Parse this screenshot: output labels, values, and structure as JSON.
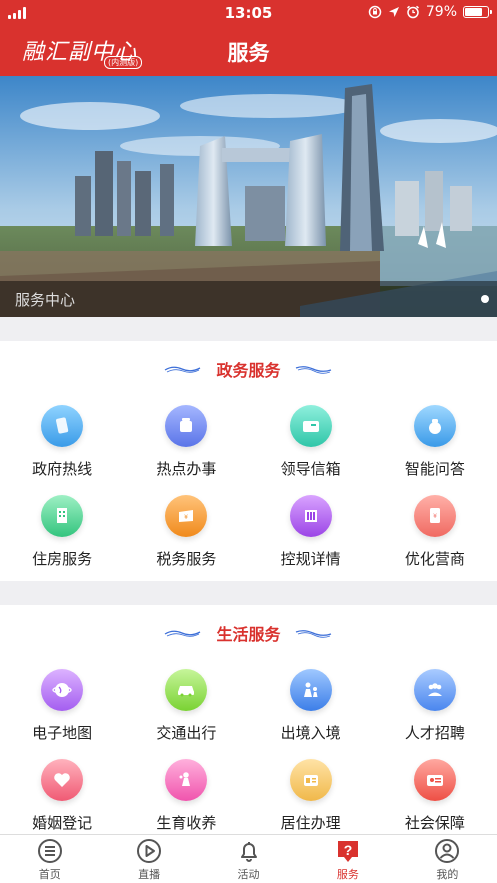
{
  "status_bar": {
    "time": "13:05",
    "battery_percent": "79%",
    "battery_level": 0.79
  },
  "nav": {
    "logo_text": "融汇副中心",
    "logo_sub": "内测版",
    "title": "服务"
  },
  "banner": {
    "caption": "服务中心"
  },
  "sections": [
    {
      "title": "政务服务",
      "items": [
        {
          "label": "政府热线",
          "icon": "phone-icon",
          "color_a": "#8fd3ff",
          "color_b": "#3a9be8"
        },
        {
          "label": "热点办事",
          "icon": "document-icon",
          "color_a": "#a5b7ff",
          "color_b": "#5a74e8"
        },
        {
          "label": "领导信箱",
          "icon": "mailbox-icon",
          "color_a": "#8ff0dd",
          "color_b": "#2fc6a8"
        },
        {
          "label": "智能问答",
          "icon": "bag-icon",
          "color_a": "#9fd8ff",
          "color_b": "#3a9ae8"
        },
        {
          "label": "住房服务",
          "icon": "building-icon",
          "color_a": "#9ef0c4",
          "color_b": "#33c47e"
        },
        {
          "label": "税务服务",
          "icon": "ticket-icon",
          "color_a": "#ffc37a",
          "color_b": "#f08a1c"
        },
        {
          "label": "控规详情",
          "icon": "city-icon",
          "color_a": "#d9a3ff",
          "color_b": "#9b45e6"
        },
        {
          "label": "优化营商",
          "icon": "envelope-money-icon",
          "color_a": "#ffb0a8",
          "color_b": "#f06a62"
        }
      ]
    },
    {
      "title": "生活服务",
      "items": [
        {
          "label": "电子地图",
          "icon": "globe-icon",
          "color_a": "#dcb2ff",
          "color_b": "#a45ef0"
        },
        {
          "label": "交通出行",
          "icon": "car-icon",
          "color_a": "#c6f59a",
          "color_b": "#7ad233"
        },
        {
          "label": "出境入境",
          "icon": "family-icon",
          "color_a": "#9fc8ff",
          "color_b": "#3c7ee8"
        },
        {
          "label": "人才招聘",
          "icon": "people-icon",
          "color_a": "#a9cbff",
          "color_b": "#4a86ee"
        },
        {
          "label": "婚姻登记",
          "icon": "heart-icon",
          "color_a": "#ffb2bd",
          "color_b": "#f05a74"
        },
        {
          "label": "生育收养",
          "icon": "woman-icon",
          "color_a": "#ffb0dc",
          "color_b": "#f054ad"
        },
        {
          "label": "居住办理",
          "icon": "residence-icon",
          "color_a": "#ffe3a6",
          "color_b": "#f0b84a"
        },
        {
          "label": "社会保障",
          "icon": "id-card-icon",
          "color_a": "#ffa8a0",
          "color_b": "#ee4f45"
        }
      ]
    }
  ],
  "tabs": [
    {
      "label": "首页",
      "icon": "menu-circle-icon",
      "active": false
    },
    {
      "label": "直播",
      "icon": "play-circle-icon",
      "active": false
    },
    {
      "label": "活动",
      "icon": "bell-icon",
      "active": false
    },
    {
      "label": "服务",
      "icon": "help-square-icon",
      "active": true
    },
    {
      "label": "我的",
      "icon": "user-circle-icon",
      "active": false
    }
  ],
  "colors": {
    "brand_red": "#d9322e",
    "page_bg": "#efeff2"
  }
}
